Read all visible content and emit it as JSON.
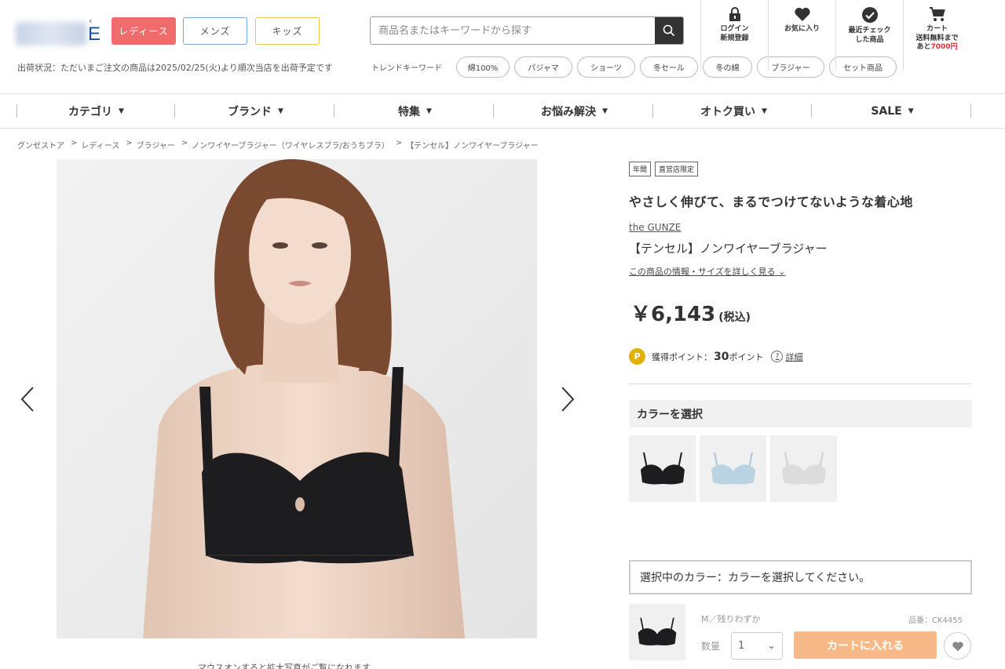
{
  "header": {
    "logo_fragment": "E",
    "logo_mark": "‹",
    "gender_tabs": [
      "レディース",
      "メンズ",
      "キッズ"
    ],
    "shipping_notice": "出荷状況：ただいまご注文の商品は2025/02/25(火)より順次当店を出荷予定です",
    "search_placeholder": "商品名またはキーワードから探す",
    "trend_label": "トレンドキーワード",
    "trend_keywords": [
      "綿100%",
      "パジャマ",
      "ショーツ",
      "冬セール",
      "冬の綿",
      "ブラジャー",
      "セット商品"
    ],
    "icons": [
      {
        "icon": "lock-icon",
        "line1": "ログイン",
        "line2": "新規登録"
      },
      {
        "icon": "heart-icon",
        "line1": "お気に入り",
        "line2": ""
      },
      {
        "icon": "check-circle-icon",
        "line1": "最近チェック",
        "line2": "した商品"
      },
      {
        "icon": "cart-icon",
        "line1": "カート",
        "line2": "送料無料まで",
        "line3_prefix": "あと",
        "line3_amount": "7000円"
      }
    ]
  },
  "nav": [
    "カテゴリ",
    "ブランド",
    "特集",
    "お悩み解決",
    "オトク買い",
    "SALE"
  ],
  "breadcrumb": [
    "グンゼストア",
    "レディース",
    "ブラジャー",
    "ノンワイヤーブラジャー（ワイヤレスブラ/おうちブラ）",
    "【テンセル】ノンワイヤーブラジャー"
  ],
  "gallery": {
    "caption": "マウスオンすると拡大写真がご覧になれます"
  },
  "product": {
    "badges": [
      "年間",
      "直営店限定"
    ],
    "headline": "やさしく伸びて、まるでつけてないような着心地",
    "brand": "the GUNZE",
    "name": "【テンセル】ノンワイヤーブラジャー",
    "detail_link": "この商品の情報・サイズを詳しく見る",
    "price": "￥6,143",
    "tax_label": "(税込)",
    "points_prefix": "獲得ポイント：",
    "points_value": "30",
    "points_unit": "ポイント",
    "points_help": "詳細",
    "color_heading": "カラーを選択",
    "swatches": [
      "black",
      "light-blue",
      "light-gray"
    ],
    "selected_color_text": "選択中のカラー：カラーを選択してください。",
    "size_stock": "M／残りわずか",
    "sku": "品番：CK4455",
    "qty_label": "数量",
    "qty_value": "1",
    "cart_button": "カートに入れる"
  },
  "colors": {
    "ladies_tab": "#f06b6b",
    "point_coin": "#e2b100",
    "cart_button": "#f6b987",
    "free_shipping_amount": "#d33333"
  }
}
